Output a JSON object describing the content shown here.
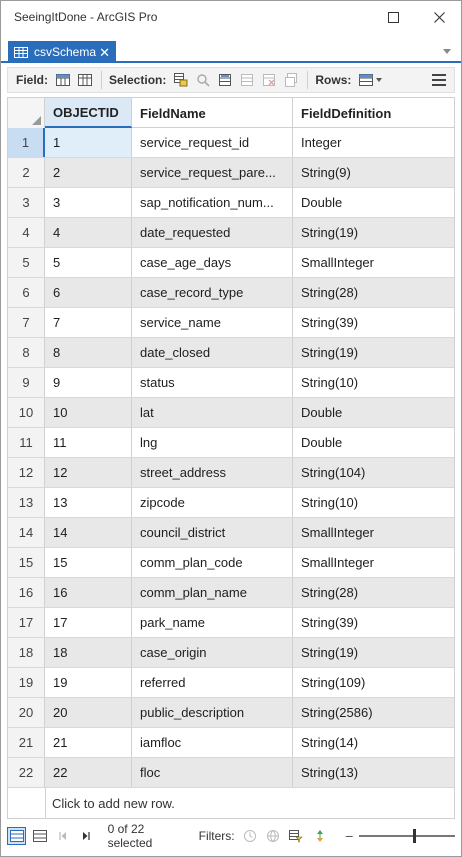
{
  "window": {
    "title": "SeeingItDone - ArcGIS Pro"
  },
  "tab": {
    "label": "csvSchema",
    "close_glyph": "✕"
  },
  "toolbar": {
    "field_label": "Field:",
    "selection_label": "Selection:",
    "rows_label": "Rows:"
  },
  "table": {
    "columns": [
      "OBJECTID",
      "FieldName",
      "FieldDefinition"
    ],
    "rows": [
      {
        "n": "1",
        "id": "1",
        "name": "service_request_id",
        "def": "Integer"
      },
      {
        "n": "2",
        "id": "2",
        "name": "service_request_pare...",
        "def": "String(9)"
      },
      {
        "n": "3",
        "id": "3",
        "name": "sap_notification_num...",
        "def": "Double"
      },
      {
        "n": "4",
        "id": "4",
        "name": "date_requested",
        "def": "String(19)"
      },
      {
        "n": "5",
        "id": "5",
        "name": "case_age_days",
        "def": "SmallInteger"
      },
      {
        "n": "6",
        "id": "6",
        "name": "case_record_type",
        "def": "String(28)"
      },
      {
        "n": "7",
        "id": "7",
        "name": "service_name",
        "def": "String(39)"
      },
      {
        "n": "8",
        "id": "8",
        "name": "date_closed",
        "def": "String(19)"
      },
      {
        "n": "9",
        "id": "9",
        "name": "status",
        "def": "String(10)"
      },
      {
        "n": "10",
        "id": "10",
        "name": "lat",
        "def": "Double"
      },
      {
        "n": "11",
        "id": "11",
        "name": "lng",
        "def": "Double"
      },
      {
        "n": "12",
        "id": "12",
        "name": "street_address",
        "def": "String(104)"
      },
      {
        "n": "13",
        "id": "13",
        "name": "zipcode",
        "def": "String(10)"
      },
      {
        "n": "14",
        "id": "14",
        "name": "council_district",
        "def": "SmallInteger"
      },
      {
        "n": "15",
        "id": "15",
        "name": "comm_plan_code",
        "def": "SmallInteger"
      },
      {
        "n": "16",
        "id": "16",
        "name": "comm_plan_name",
        "def": "String(28)"
      },
      {
        "n": "17",
        "id": "17",
        "name": "park_name",
        "def": "String(39)"
      },
      {
        "n": "18",
        "id": "18",
        "name": "case_origin",
        "def": "String(19)"
      },
      {
        "n": "19",
        "id": "19",
        "name": "referred",
        "def": "String(109)"
      },
      {
        "n": "20",
        "id": "20",
        "name": "public_description",
        "def": "String(2586)"
      },
      {
        "n": "21",
        "id": "21",
        "name": "iamfloc",
        "def": "String(14)"
      },
      {
        "n": "22",
        "id": "22",
        "name": "floc",
        "def": "String(13)"
      }
    ],
    "add_row_text": "Click to add new row."
  },
  "status": {
    "selected_text": "0 of 22 selected",
    "filters_label": "Filters:",
    "zoom_fraction": 0.55
  },
  "colors": {
    "accent": "#2a6ebb",
    "alt_row": "#e8e8e8"
  }
}
